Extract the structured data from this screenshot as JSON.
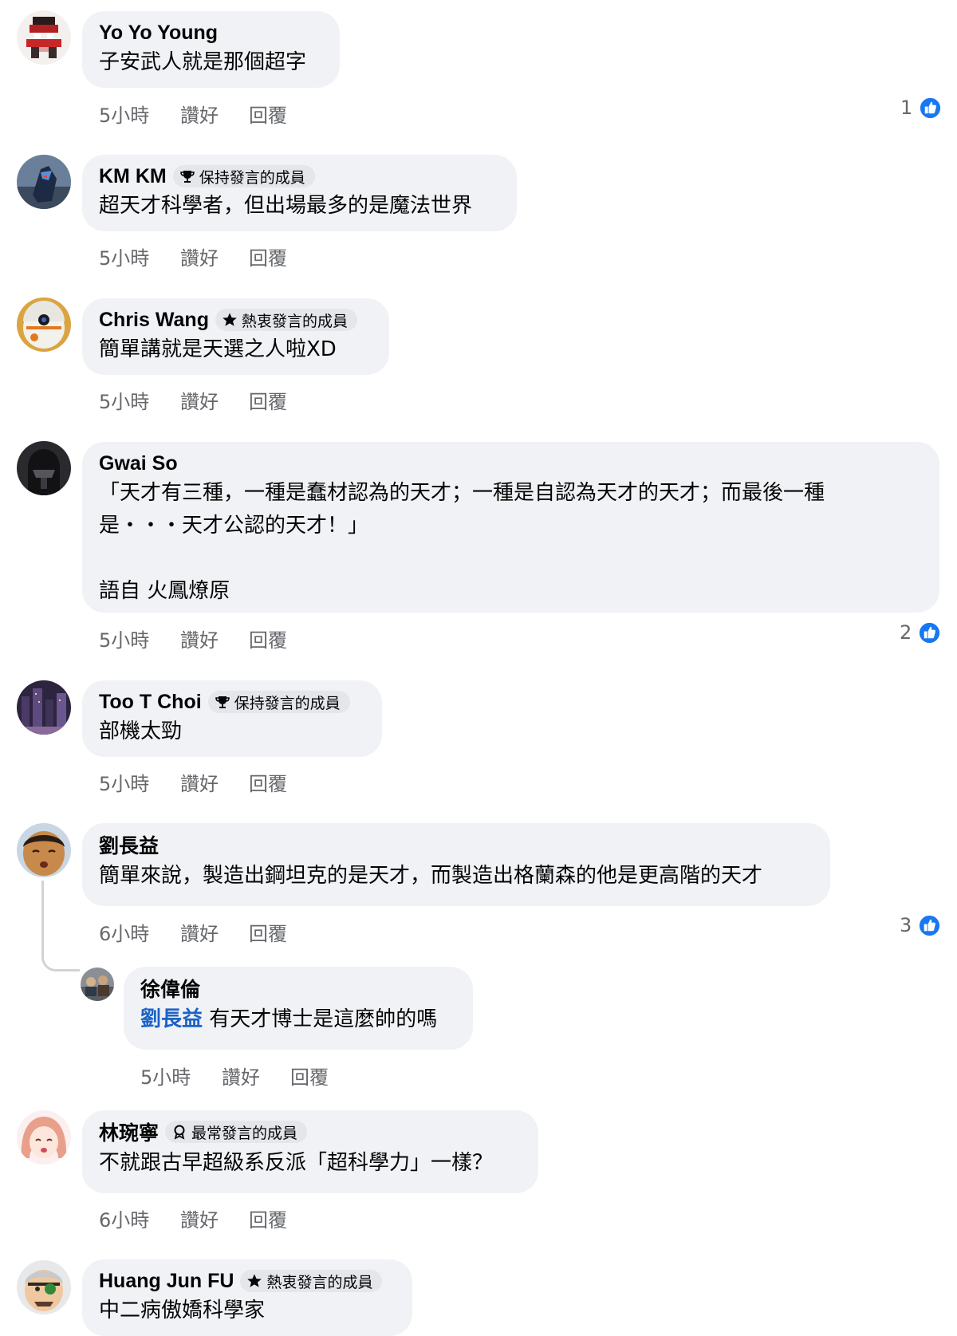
{
  "labels": {
    "like": "讚好",
    "reply": "回覆"
  },
  "colors": {
    "bubble": "#f0f2f5",
    "meta": "#65676b",
    "mention": "#1b62c8",
    "like_blue": "#1877f2"
  },
  "comments": [
    {
      "author": "Yo Yo Young",
      "badge": null,
      "text": "子安武人就是那個超字",
      "time": "5小時",
      "reactions": "1",
      "avatar_icon": "pixel-art-avatar"
    },
    {
      "author": "KM KM",
      "badge": {
        "label": "保持發言的成員",
        "icon": "trophy-icon"
      },
      "text": "超天才科學者，但出場最多的是魔法世界",
      "time": "5小時",
      "reactions": null,
      "avatar_icon": "robot-avatar"
    },
    {
      "author": "Chris Wang",
      "badge": {
        "label": "熱衷發言的成員",
        "icon": "star-icon"
      },
      "text": "簡單講就是天選之人啦XD",
      "time": "5小時",
      "reactions": null,
      "avatar_icon": "droid-avatar"
    },
    {
      "author": "Gwai So",
      "badge": null,
      "text": "「天才有三種，一種是蠢材認為的天才；一種是自認為天才的天才；而最後一種\n是・・・天才公認的天才！」\n\n語自 火鳳燎原",
      "time": "5小時",
      "reactions": "2",
      "avatar_icon": "dark-helmet-avatar"
    },
    {
      "author": "Too T Choi",
      "badge": {
        "label": "保持發言的成員",
        "icon": "trophy-icon"
      },
      "text": "部機太勁",
      "time": "5小時",
      "reactions": null,
      "avatar_icon": "city-night-avatar"
    },
    {
      "author": "劉長益",
      "badge": null,
      "text": "簡單來說，製造出鋼坦克的是天才，而製造出格蘭森的他是更高階的天才",
      "time": "6小時",
      "reactions": "3",
      "avatar_icon": "cartoon-face-avatar"
    },
    {
      "author": "徐偉倫",
      "badge": null,
      "mention": "劉長益",
      "text": " 有天才博士是這麼帥的嗎",
      "time": "5小時",
      "reactions": null,
      "avatar_icon": "group-photo-avatar"
    },
    {
      "author": "林琬寧",
      "badge": {
        "label": "最常發言的成員",
        "icon": "ribbon-icon"
      },
      "text": "不就跟古早超級系反派「超科學力」一樣？",
      "time": "6小時",
      "reactions": null,
      "avatar_icon": "anime-girl-avatar"
    },
    {
      "author": "Huang Jun FU",
      "badge": {
        "label": "熱衷發言的成員",
        "icon": "star-icon"
      },
      "text": "中二病傲嬌科學家",
      "time": null,
      "reactions": null,
      "avatar_icon": "eyepatch-face-avatar"
    }
  ]
}
